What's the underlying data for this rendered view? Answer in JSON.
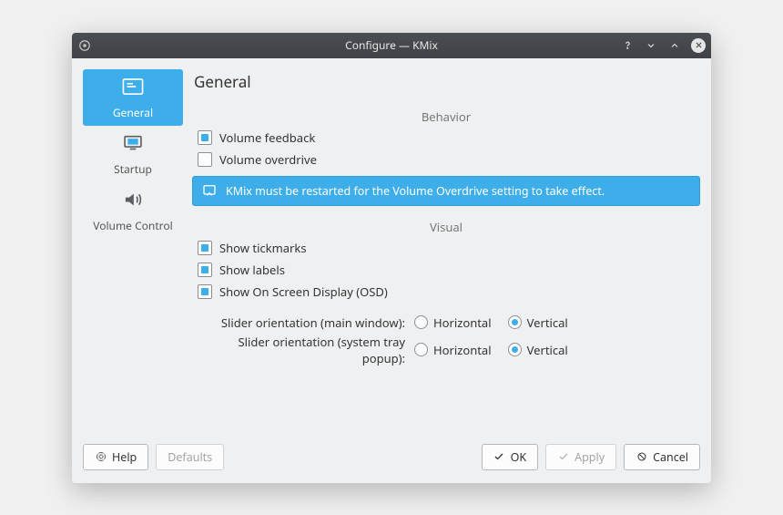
{
  "title": "Configure — KMix",
  "sidebar": {
    "items": [
      {
        "label": "General"
      },
      {
        "label": "Startup"
      },
      {
        "label": "Volume Control"
      }
    ]
  },
  "page": {
    "title": "General",
    "behavior_head": "Behavior",
    "visual_head": "Visual",
    "volume_feedback": "Volume feedback",
    "volume_overdrive": "Volume overdrive",
    "info_msg": "KMix must be restarted for the Volume Overdrive setting to take effect.",
    "show_tickmarks": "Show tickmarks",
    "show_labels": "Show labels",
    "show_osd": "Show On Screen Display (OSD)",
    "orient_main_label": "Slider orientation (main window):",
    "orient_tray_label": "Slider orientation (system tray popup):",
    "horizontal": "Horizontal",
    "vertical": "Vertical"
  },
  "buttons": {
    "help": "Help",
    "defaults": "Defaults",
    "ok": "OK",
    "apply": "Apply",
    "cancel": "Cancel"
  }
}
